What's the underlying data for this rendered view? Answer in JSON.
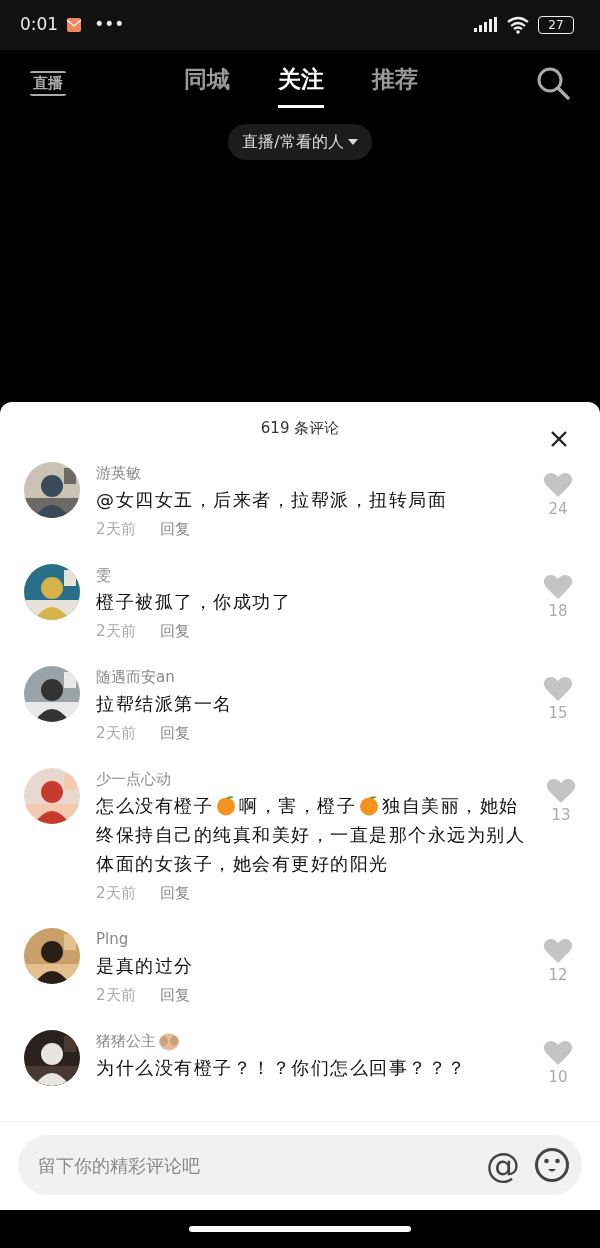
{
  "status_bar": {
    "time": "0:01",
    "more": "•••",
    "battery": "27"
  },
  "header": {
    "logo": "直播",
    "tabs": [
      {
        "label": "同城",
        "selected": false
      },
      {
        "label": "关注",
        "selected": true
      },
      {
        "label": "推荐",
        "selected": false
      }
    ],
    "filter": "直播/常看的人"
  },
  "comments_panel": {
    "title": "619 条评论",
    "comments": [
      {
        "user": "游英敏",
        "parts": [
          {
            "kind": "text",
            "text": "@女四女五，后来者，拉帮派，扭转局面"
          }
        ],
        "time": "2天前",
        "reply": "回复",
        "likes": "24",
        "liked": false
      },
      {
        "user": "雯",
        "parts": [
          {
            "kind": "text",
            "text": "橙子被孤了，你成功了"
          }
        ],
        "time": "2天前",
        "reply": "回复",
        "likes": "18",
        "liked": false
      },
      {
        "user": "随遇而安an",
        "parts": [
          {
            "kind": "text",
            "text": "拉帮结派第一名"
          }
        ],
        "time": "2天前",
        "reply": "回复",
        "likes": "15",
        "liked": false
      },
      {
        "user": "少一点心动",
        "parts": [
          {
            "kind": "text",
            "text": "怎么没有橙子"
          },
          {
            "kind": "orange"
          },
          {
            "kind": "text",
            "text": "啊，害，橙子"
          },
          {
            "kind": "orange"
          },
          {
            "kind": "text",
            "text": "独自美丽，她始终保持自己的纯真和美好，一直是那个永远为别人体面的女孩子，她会有更好的阳光"
          }
        ],
        "time": "2天前",
        "reply": "回复",
        "likes": "13",
        "liked": false
      },
      {
        "user": "Plng",
        "parts": [
          {
            "kind": "text",
            "text": "是真的过分"
          }
        ],
        "time": "2天前",
        "reply": "回复",
        "likes": "12",
        "liked": false
      },
      {
        "user": "猪猪公主",
        "user_emoji": true,
        "parts": [
          {
            "kind": "text",
            "text": "为什么没有橙子？！？你们怎么回事？？？"
          }
        ],
        "likes": "10",
        "liked": false
      }
    ],
    "input": {
      "placeholder": "留下你的精彩评论吧",
      "at": "@"
    }
  }
}
